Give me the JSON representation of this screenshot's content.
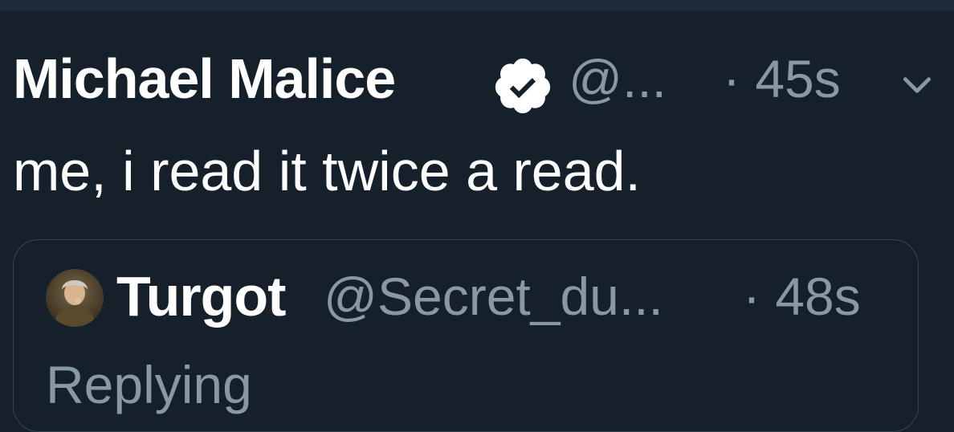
{
  "tweet": {
    "author_name": "Michael Malice",
    "handle": "@...",
    "time": "· 45s",
    "text": "me, i read it twice a read."
  },
  "quoted_tweet": {
    "author_name": "Turgot",
    "handle": "@Secret_du...",
    "time": "· 48s",
    "replying": "Replying"
  },
  "icons": {
    "verified": "verified-badge-icon",
    "menu": "chevron-down-icon",
    "avatar": "avatar"
  },
  "colors": {
    "background": "#15202b",
    "primary_text": "#ffffff",
    "secondary_text": "#8899a6",
    "border": "#38444d"
  }
}
